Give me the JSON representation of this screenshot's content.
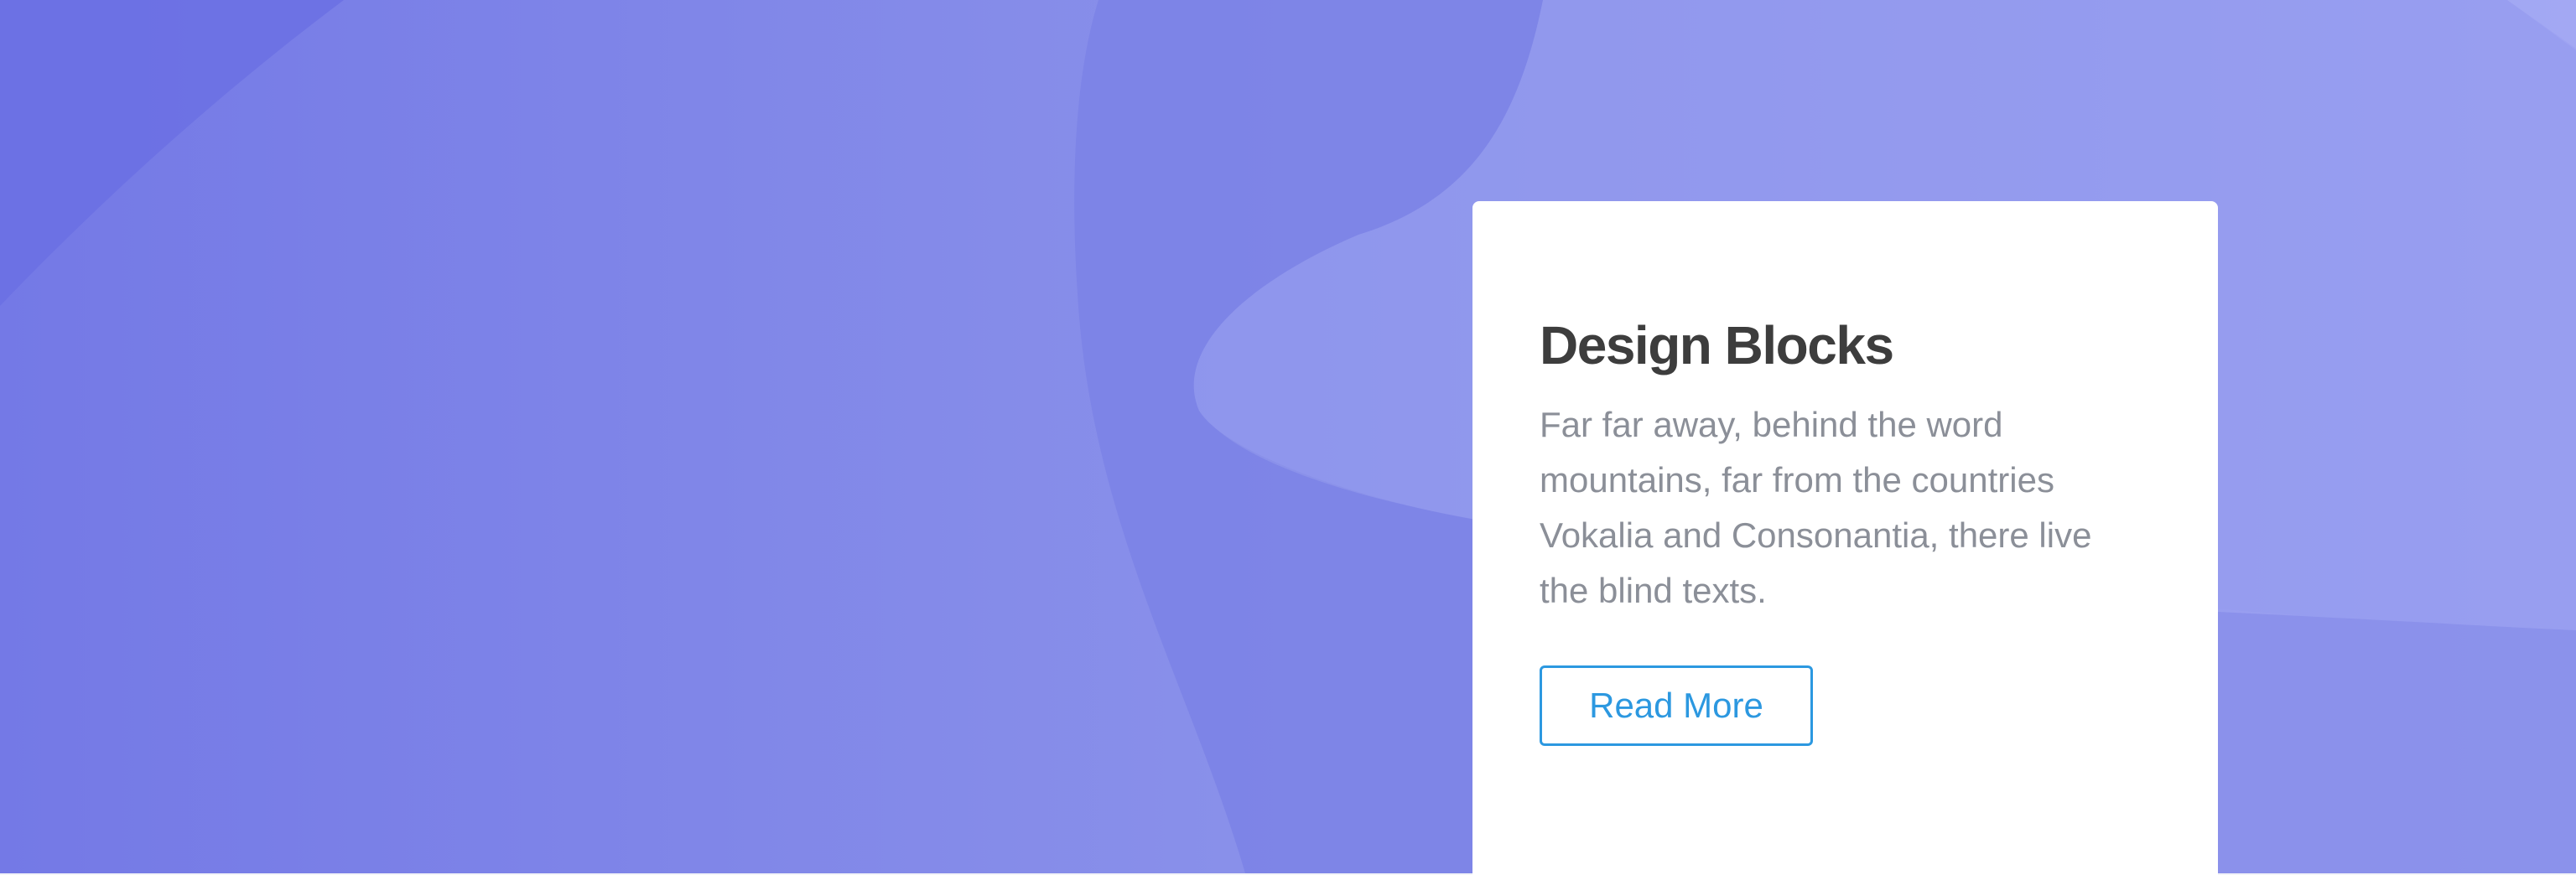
{
  "card": {
    "title": "Design Blocks",
    "text": "Far far away, behind the word mountains, far from the countries Vokalia and Consonantia, there live the blind texts.",
    "button_label": "Read More"
  },
  "colors": {
    "background_start": "#7479e6",
    "background_end": "#9ea3f2",
    "card_background": "#ffffff",
    "title_color": "#3d3d3d",
    "text_color": "#8b8f98",
    "button_accent": "#2c98e0"
  }
}
